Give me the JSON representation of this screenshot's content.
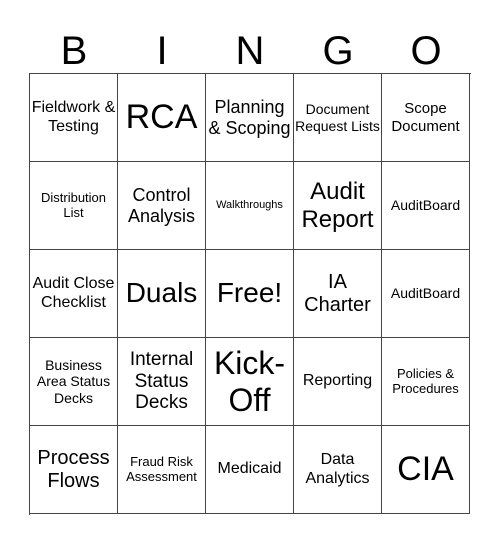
{
  "header": {
    "letters": [
      "B",
      "I",
      "N",
      "G",
      "O"
    ]
  },
  "cells": [
    "Fieldwork & Testing",
    "RCA",
    "Planning & Scoping",
    "Document Request Lists",
    "Scope Document",
    "Distribution List",
    "Control Analysis",
    "Walkthroughs",
    "Audit Report",
    "AuditBoard",
    "Audit Close Checklist",
    "Duals",
    "Free!",
    "IA Charter",
    "AuditBoard",
    "Business Area Status Decks",
    "Internal Status Decks",
    "Kick-Off",
    "Reporting",
    "Policies & Procedures",
    "Process Flows",
    "Fraud Risk Assessment",
    "Medicaid",
    "Data Analytics",
    "CIA"
  ]
}
